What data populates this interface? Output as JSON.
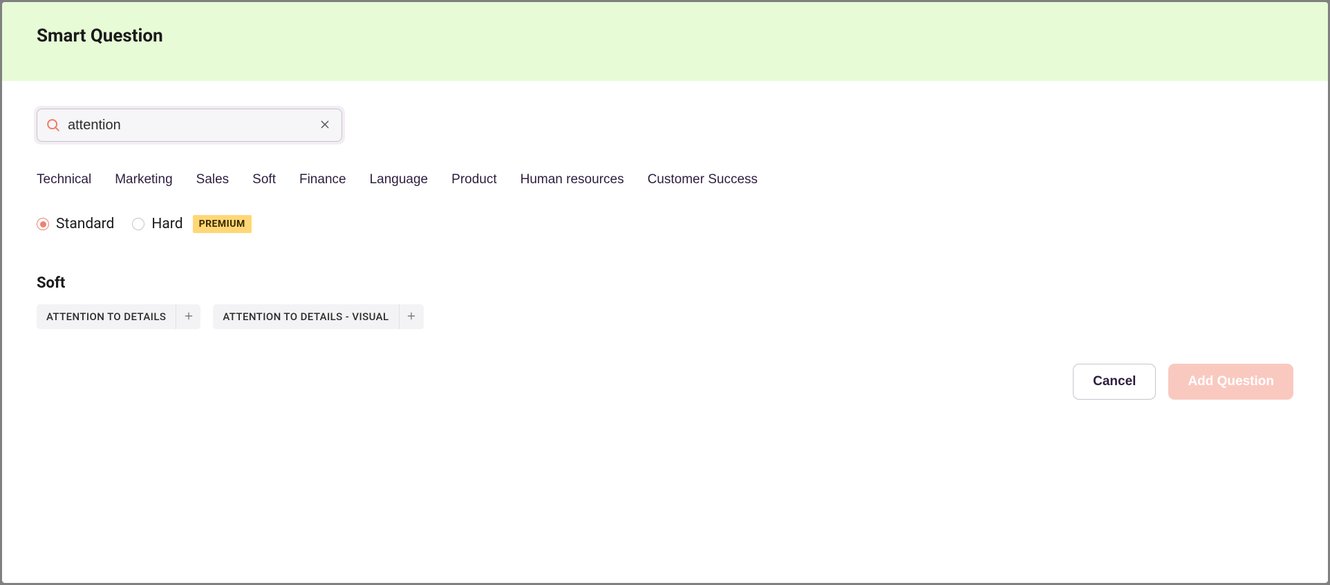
{
  "header": {
    "title": "Smart Question"
  },
  "search": {
    "value": "attention",
    "placeholder": ""
  },
  "tabs": [
    {
      "label": "Technical"
    },
    {
      "label": "Marketing"
    },
    {
      "label": "Sales"
    },
    {
      "label": "Soft"
    },
    {
      "label": "Finance"
    },
    {
      "label": "Language"
    },
    {
      "label": "Product"
    },
    {
      "label": "Human resources"
    },
    {
      "label": "Customer Success"
    }
  ],
  "difficulty": {
    "options": [
      {
        "label": "Standard",
        "selected": true
      },
      {
        "label": "Hard",
        "selected": false
      }
    ],
    "premium_badge": "PREMIUM"
  },
  "section": {
    "title": "Soft",
    "chips": [
      {
        "label": "ATTENTION TO DETAILS"
      },
      {
        "label": "ATTENTION TO DETAILS - VISUAL"
      }
    ]
  },
  "footer": {
    "cancel_label": "Cancel",
    "add_label": "Add Question"
  }
}
